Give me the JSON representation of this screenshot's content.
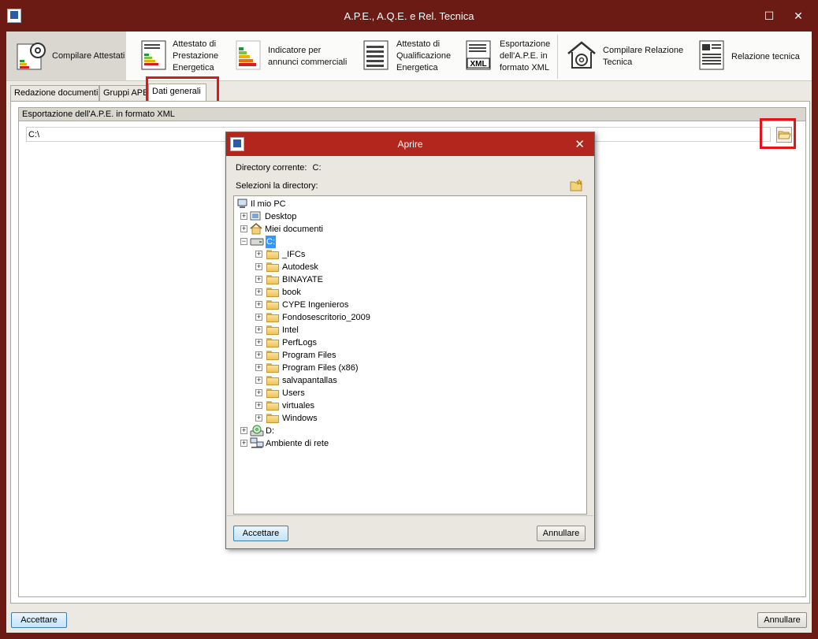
{
  "window": {
    "title": "A.P.E., A.Q.E. e Rel. Tecnica",
    "maximize": "☐",
    "close": "✕"
  },
  "ribbon": {
    "items": [
      {
        "label": "Compilare Attestati"
      },
      {
        "label": "Attestato di\nPrestazione\nEnergetica"
      },
      {
        "label": "Indicatore per\nannunci commerciali"
      },
      {
        "label": "Attestato di\nQualificazione\nEnergetica"
      },
      {
        "label": "Esportazione\ndell'A.P.E. in\nformato XML",
        "xml": "XML"
      },
      {
        "label": "Compilare Relazione\nTecnica"
      },
      {
        "label": "Relazione tecnica"
      }
    ]
  },
  "tabs": [
    {
      "label": "Redazione documenti"
    },
    {
      "label": "Gruppi APE"
    },
    {
      "label": "Dati generali"
    }
  ],
  "group": {
    "title": "Esportazione dell'A.P.E. in formato XML",
    "path_value": "C:\\"
  },
  "footer": {
    "accept": "Accettare",
    "cancel": "Annullare"
  },
  "dialog": {
    "title": "Aprire",
    "current_dir_label": "Directory corrente:",
    "current_dir_value": "C:",
    "select_label": "Selezioni la directory:",
    "accept": "Accettare",
    "cancel": "Annullare",
    "tree": {
      "root": "Il mio PC",
      "desktop": "Desktop",
      "documents": "Miei documenti",
      "drive_c": "C:",
      "folders": [
        "_IFCs",
        "Autodesk",
        "BINAYATE",
        "book",
        "CYPE Ingenieros",
        "Fondosescritorio_2009",
        "Intel",
        "PerfLogs",
        "Program Files",
        "Program Files (x86)",
        "salvapantallas",
        "Users",
        "virtuales",
        "Windows"
      ],
      "drive_d": "D:",
      "network": "Ambiente di rete"
    }
  }
}
